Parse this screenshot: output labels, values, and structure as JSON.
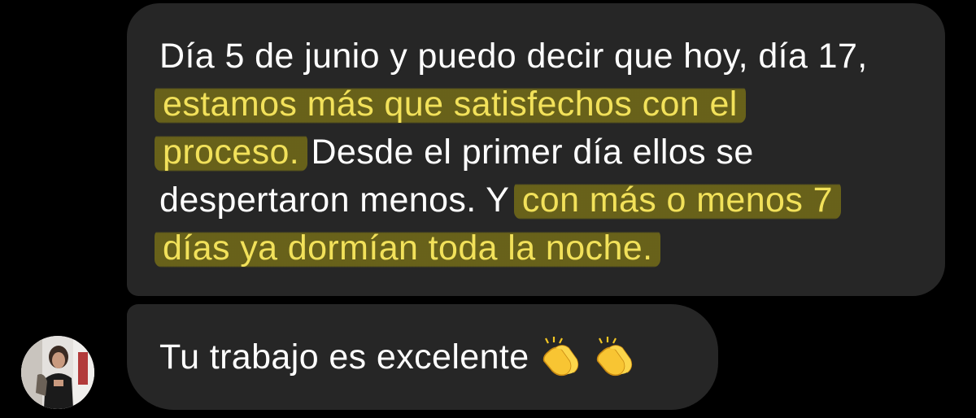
{
  "conversation": {
    "messages": [
      {
        "segments": [
          {
            "text": "Día 5 de junio y puedo decir que hoy, día 17,\n",
            "highlight": false
          },
          {
            "text": "estamos más que satisfechos con el\nproceso.",
            "highlight": true
          },
          {
            "text": " Desde el primer día ellos se\ndespertaron menos. Y ",
            "highlight": false
          },
          {
            "text": "con más o menos 7\ndías ya dormían toda la noche.",
            "highlight": true
          }
        ]
      },
      {
        "text": "Tu trabajo es excelente",
        "emojis": [
          "clapping-hands-icon",
          "clapping-hands-icon"
        ]
      }
    ],
    "sender_avatar": "avatar-photo"
  },
  "colors": {
    "background": "#000000",
    "bubble": "#262626",
    "text": "#ffffff",
    "highlight_text": "#f2e15a",
    "highlight_bg": "#7a7216"
  }
}
